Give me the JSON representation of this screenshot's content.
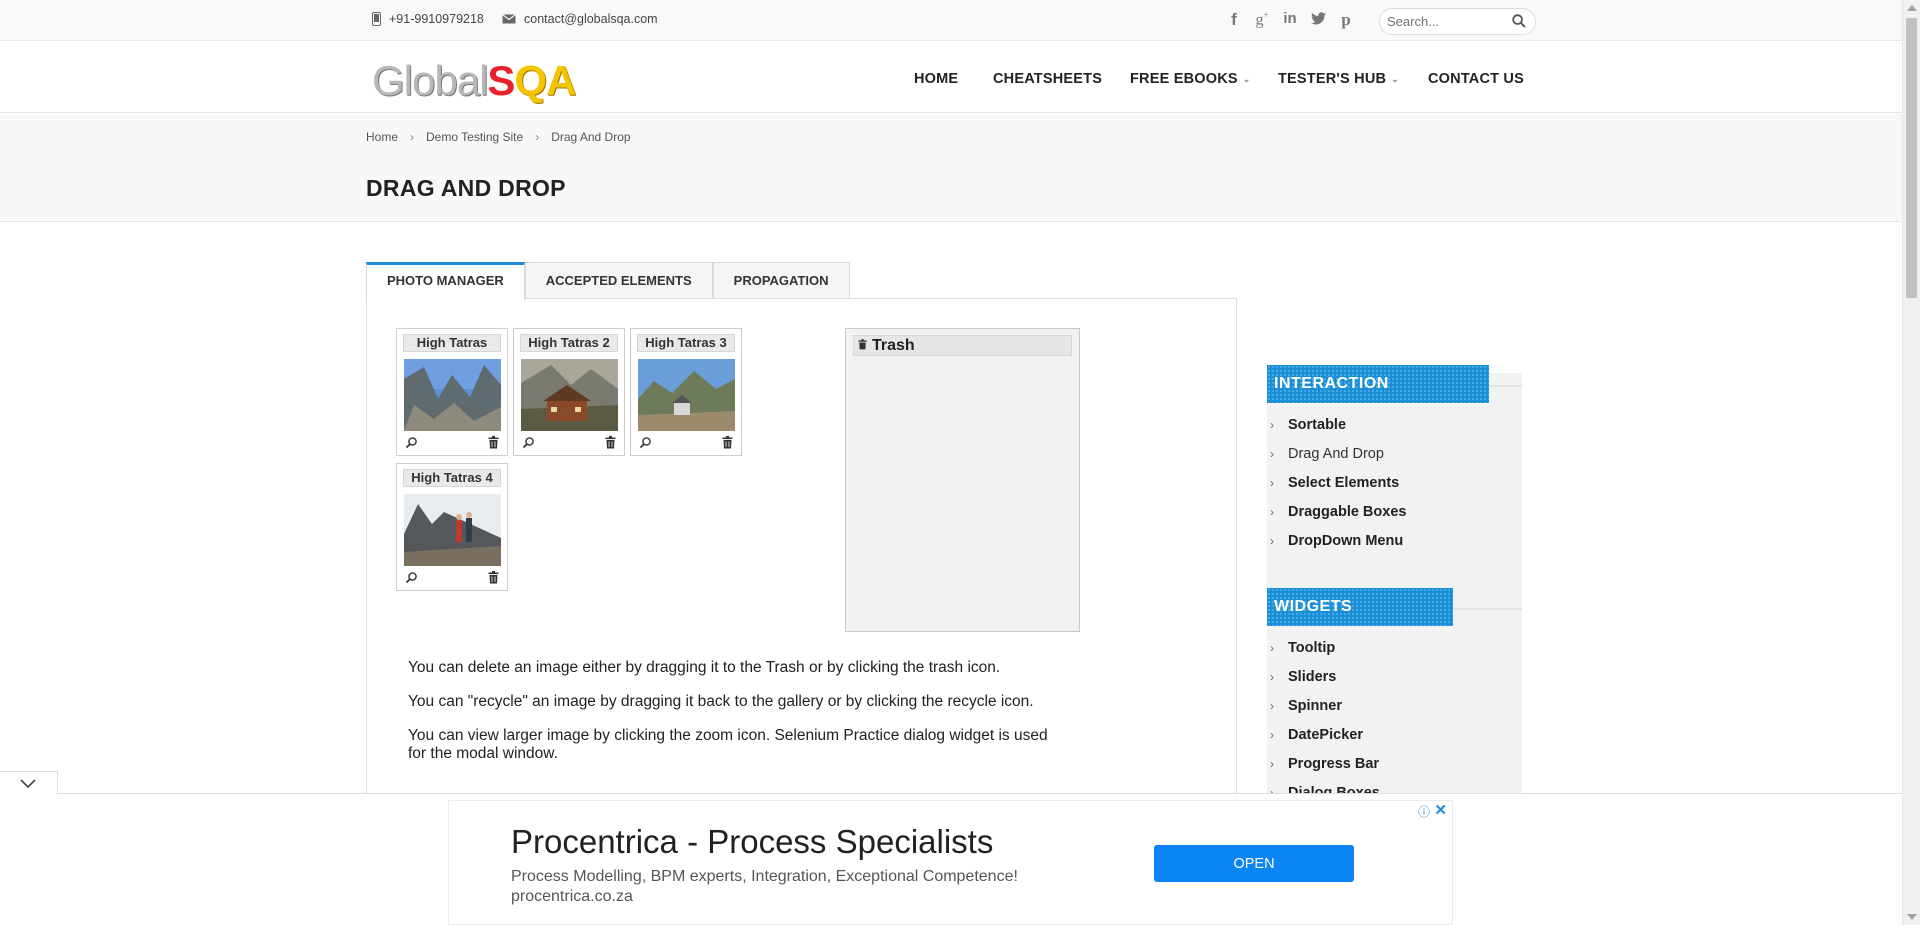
{
  "topbar": {
    "phone": "+91-9910979218",
    "email": "contact@globalsqa.com",
    "social_icons": [
      "facebook-icon",
      "google-plus-icon",
      "linkedin-icon",
      "twitter-icon",
      "pinterest-icon"
    ],
    "search_placeholder": "Search..."
  },
  "logo": {
    "part1": "Global",
    "part2": "S",
    "part3": "QA"
  },
  "nav": {
    "items": [
      {
        "label": "HOME"
      },
      {
        "label": "CHEATSHEETS"
      },
      {
        "label": "FREE EBOOKS",
        "has_dropdown": true
      },
      {
        "label": "TESTER'S HUB",
        "has_dropdown": true
      },
      {
        "label": "CONTACT US"
      }
    ]
  },
  "breadcrumb": [
    "Home",
    "Demo Testing Site",
    "Drag And Drop"
  ],
  "page_title": "DRAG AND DROP",
  "tabs": [
    {
      "label": "PHOTO MANAGER",
      "active": true
    },
    {
      "label": "ACCEPTED ELEMENTS",
      "active": false
    },
    {
      "label": "PROPAGATION",
      "active": false
    }
  ],
  "gallery": [
    {
      "title": "High Tatras"
    },
    {
      "title": "High Tatras 2"
    },
    {
      "title": "High Tatras 3"
    },
    {
      "title": "High Tatras 4"
    }
  ],
  "trash": {
    "title": "Trash"
  },
  "descriptions": [
    "You can delete an image either by dragging it to the Trash or by clicking the trash icon.",
    "You can \"recycle\" an image by dragging it back to the gallery or by clicking the recycle icon.",
    "You can view larger image by clicking the zoom icon. Selenium Practice dialog widget is used for the modal window."
  ],
  "sidebar": {
    "interaction": {
      "heading": "INTERACTION",
      "items": [
        "Sortable",
        "Drag And Drop",
        "Select Elements",
        "Draggable Boxes",
        "DropDown Menu"
      ]
    },
    "widgets": {
      "heading": "WIDGETS",
      "items": [
        "Tooltip",
        "Sliders",
        "Spinner",
        "DatePicker",
        "Progress Bar",
        "Dialog Boxes"
      ]
    }
  },
  "ad": {
    "title": "Procentrica - Process Specialists",
    "description": "Process Modelling, BPM experts, Integration, Exceptional Competence!",
    "url": "procentrica.co.za",
    "button": "OPEN",
    "info_icon": "ⓘ",
    "close_icon": "✕"
  },
  "colors": {
    "accent": "#1a8fd6",
    "ad_button": "#0b84f4",
    "logo_red": "#e8222a",
    "logo_yellow": "#f5c400"
  }
}
